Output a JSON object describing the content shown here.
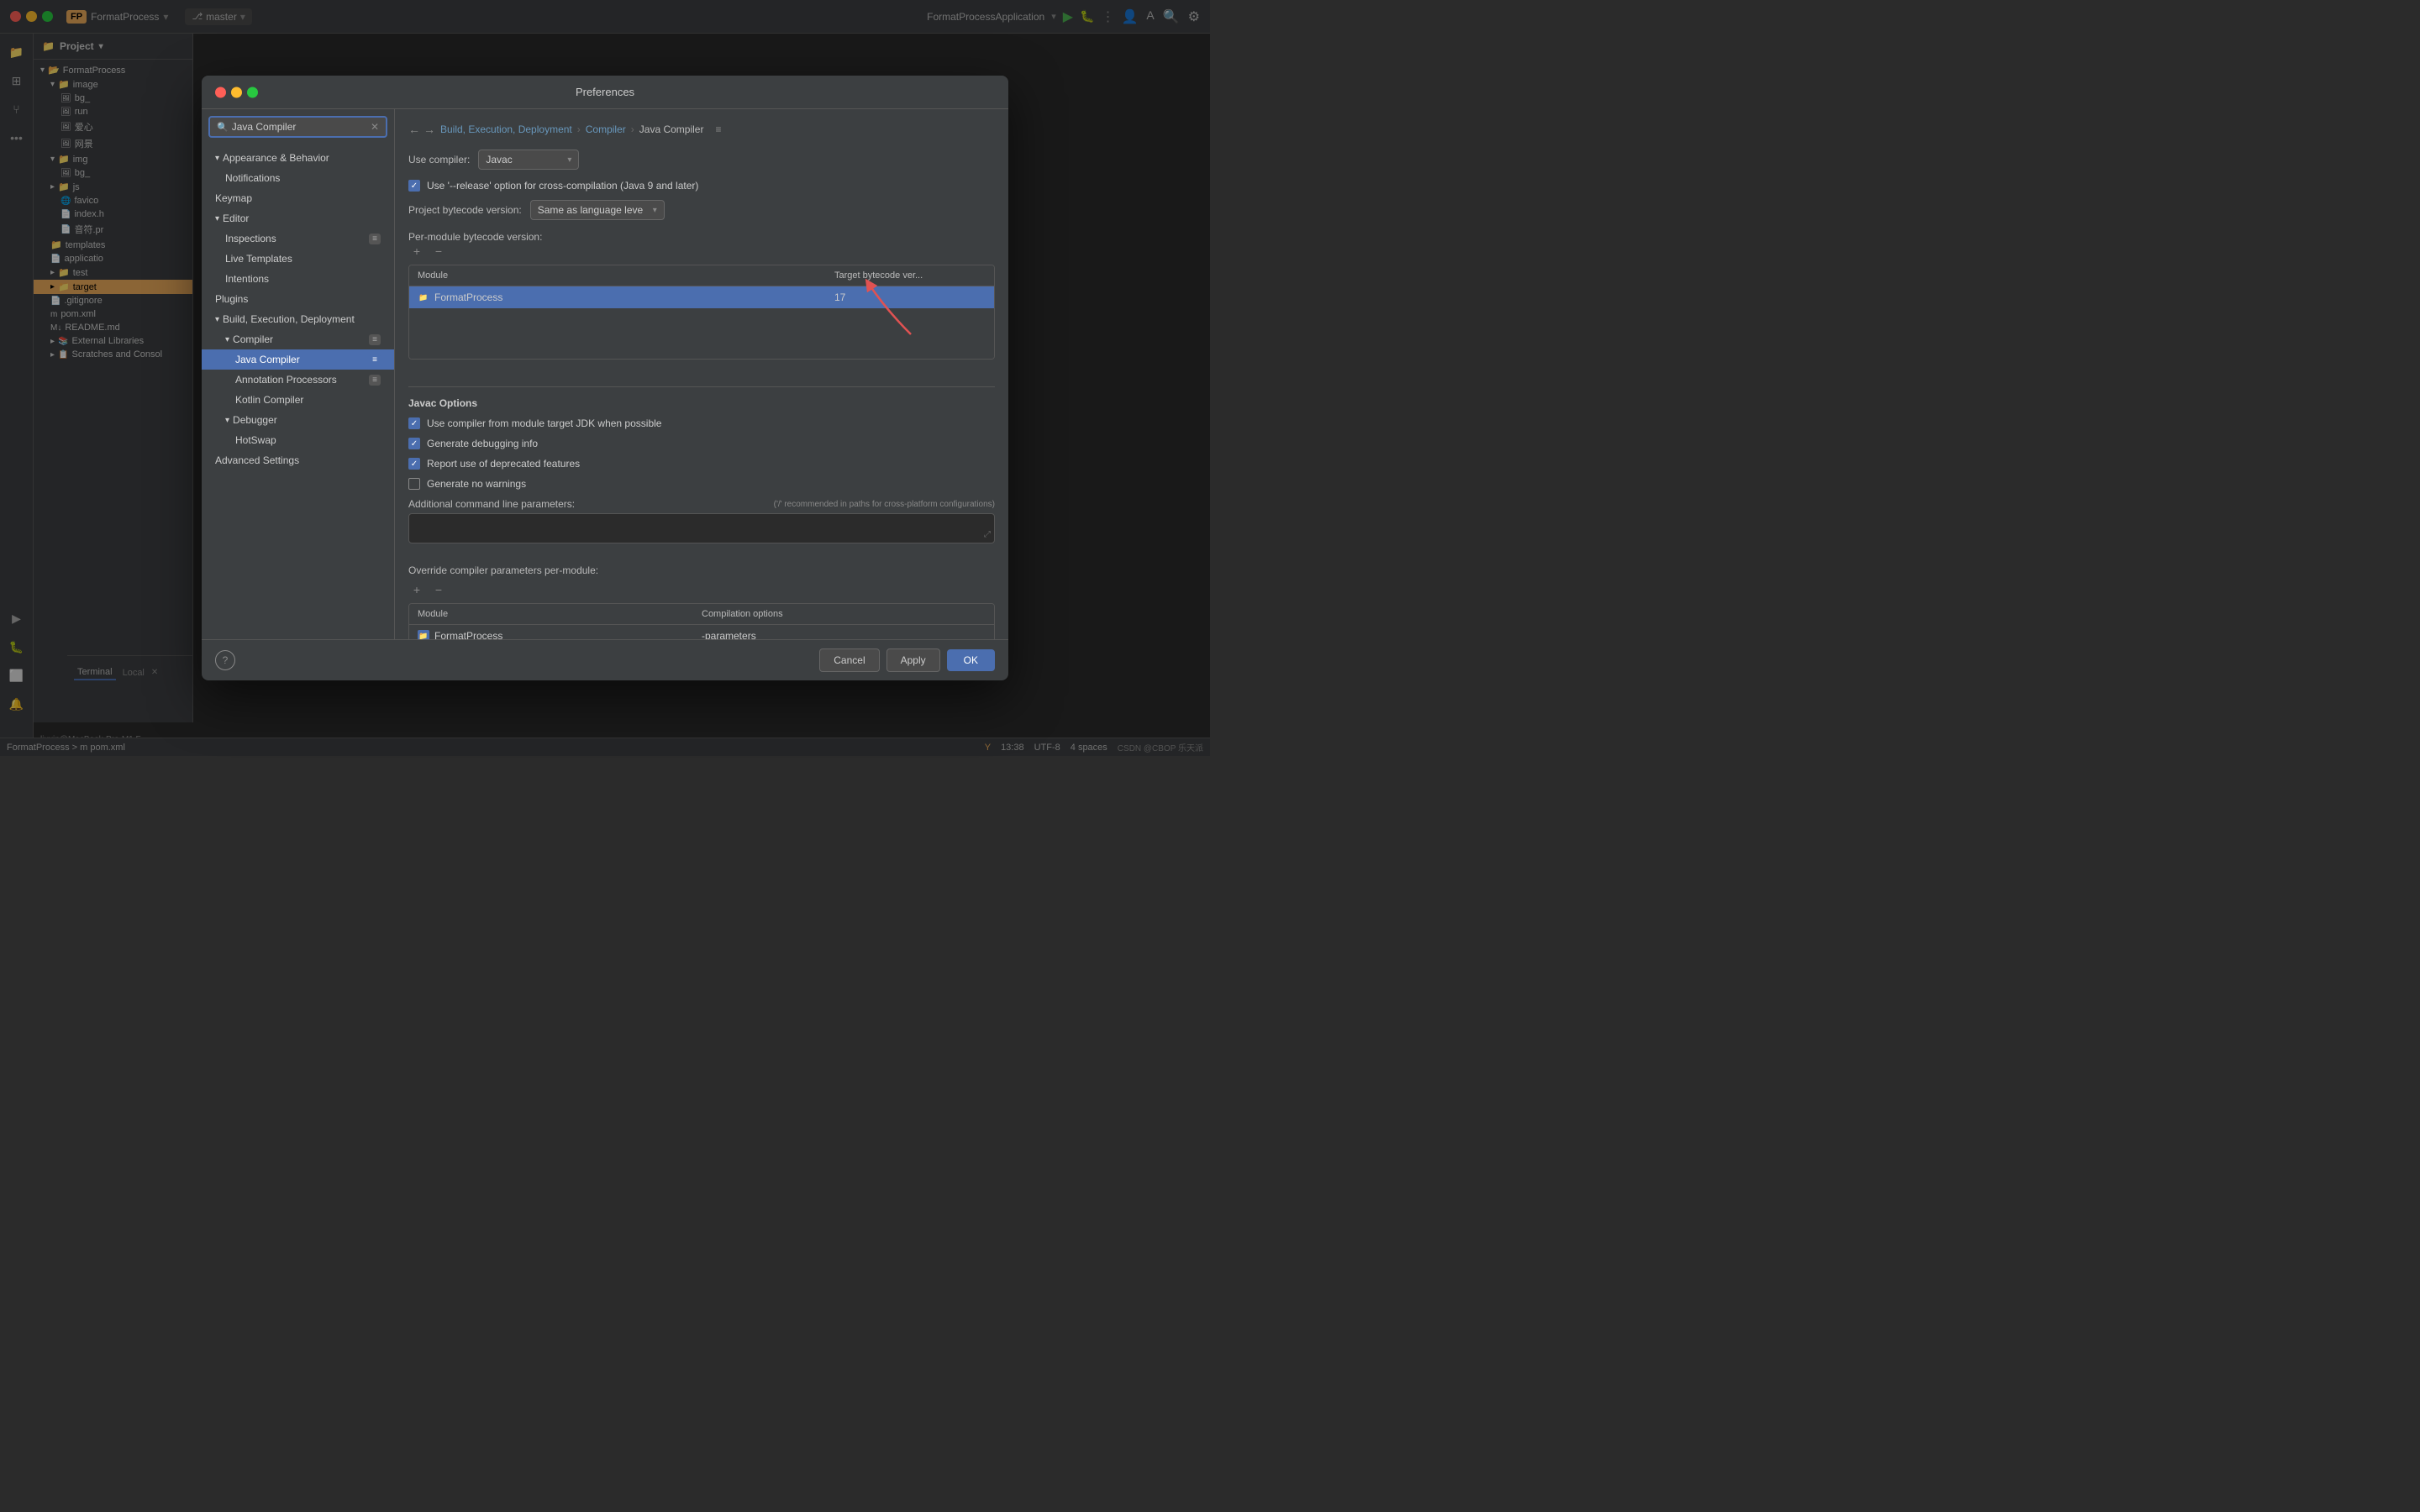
{
  "ide": {
    "title": "FormatProcess",
    "branch": "master",
    "app_name": "FormatProcessApplication",
    "status_path": "FormatProcess > m pom.xml",
    "line_col": "13:38",
    "encoding": "UTF-8",
    "indent": "4 spaces",
    "terminal_label": "Terminal",
    "local_label": "Local"
  },
  "dialog": {
    "title": "Preferences",
    "search_placeholder": "Java Compiler",
    "breadcrumb": {
      "part1": "Build, Execution, Deployment",
      "sep1": "›",
      "part2": "Compiler",
      "sep2": "›",
      "part3": "Java Compiler"
    },
    "nav": {
      "appearance_behavior": "Appearance & Behavior",
      "notifications": "Notifications",
      "keymap": "Keymap",
      "editor": "Editor",
      "inspections": "Inspections",
      "live_templates": "Live Templates",
      "intentions": "Intentions",
      "plugins": "Plugins",
      "build_exec_deploy": "Build, Execution, Deployment",
      "compiler": "Compiler",
      "java_compiler": "Java Compiler",
      "annotation_processors": "Annotation Processors",
      "kotlin_compiler": "Kotlin Compiler",
      "debugger": "Debugger",
      "hotswap": "HotSwap",
      "advanced_settings": "Advanced Settings"
    },
    "content": {
      "use_compiler_label": "Use compiler:",
      "compiler_value": "Javac",
      "cross_compile_label": "Use '--release' option for cross-compilation (Java 9 and later)",
      "bytecode_version_label": "Project bytecode version:",
      "bytecode_version_value": "Same as language leve",
      "per_module_label": "Per-module bytecode version:",
      "module_col": "Module",
      "target_col": "Target bytecode ver...",
      "module_name": "FormatProcess",
      "target_value": "17",
      "javac_options": "Javac Options",
      "opt1": "Use compiler from module target JDK when possible",
      "opt2": "Generate debugging info",
      "opt3": "Report use of deprecated features",
      "opt4": "Generate no warnings",
      "additional_params_label": "Additional command line parameters:",
      "additional_params_hint": "('/' recommended in paths for cross-platform configurations)",
      "override_label": "Override compiler parameters per-module:",
      "override_module_col": "Module",
      "override_options_col": "Compilation options",
      "override_module_name": "FormatProcess",
      "override_options_value": "-parameters"
    },
    "buttons": {
      "cancel": "Cancel",
      "apply": "Apply",
      "ok": "OK"
    }
  },
  "project_tree": {
    "items": [
      {
        "label": "image",
        "indent": 1,
        "icon": "folder"
      },
      {
        "label": "bg_",
        "indent": 2,
        "icon": "image"
      },
      {
        "label": "run",
        "indent": 2,
        "icon": "image"
      },
      {
        "label": "爱心",
        "indent": 2,
        "icon": "image"
      },
      {
        "label": "网景",
        "indent": 2,
        "icon": "image"
      },
      {
        "label": "img",
        "indent": 1,
        "icon": "folder"
      },
      {
        "label": "bg_",
        "indent": 2,
        "icon": "image"
      },
      {
        "label": "js",
        "indent": 1,
        "icon": "folder"
      },
      {
        "label": "favico",
        "indent": 2,
        "icon": "file"
      },
      {
        "label": "index.h",
        "indent": 2,
        "icon": "file"
      },
      {
        "label": "音符.pr",
        "indent": 2,
        "icon": "file"
      },
      {
        "label": "templates",
        "indent": 1,
        "icon": "folder",
        "selected": false
      },
      {
        "label": "applicatio",
        "indent": 1,
        "icon": "file"
      },
      {
        "label": "test",
        "indent": 1,
        "icon": "folder"
      },
      {
        "label": "target",
        "indent": 1,
        "icon": "folder",
        "highlighted": true
      },
      {
        "label": ".gitignore",
        "indent": 1,
        "icon": "file"
      },
      {
        "label": "pom.xml",
        "indent": 1,
        "icon": "maven"
      },
      {
        "label": "README.md",
        "indent": 1,
        "icon": "markdown"
      },
      {
        "label": "External Libraries",
        "indent": 1,
        "icon": "library"
      },
      {
        "label": "Scratches and Consol",
        "indent": 1,
        "icon": "scratch"
      }
    ]
  }
}
